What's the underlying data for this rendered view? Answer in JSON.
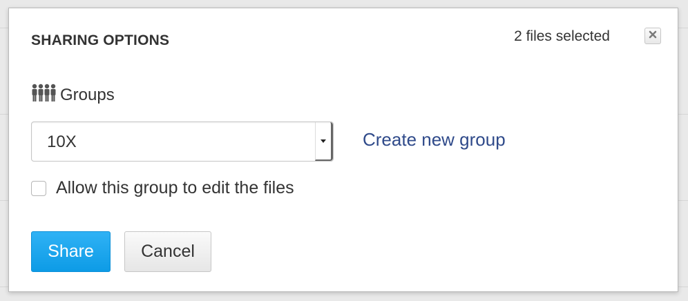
{
  "dialog": {
    "title": "SHARING OPTIONS",
    "selected_count": "2 files selected",
    "close_icon": "close-icon"
  },
  "groups": {
    "label": "Groups",
    "icon": "group-people-icon",
    "selected_value": "10X",
    "create_link": "Create new group"
  },
  "permissions": {
    "edit_label": "Allow this group to edit the files",
    "edit_checked": false
  },
  "actions": {
    "share_label": "Share",
    "cancel_label": "Cancel"
  },
  "colors": {
    "primary": "#1ba3ec",
    "link": "#2f4a8a",
    "text": "#333333"
  }
}
